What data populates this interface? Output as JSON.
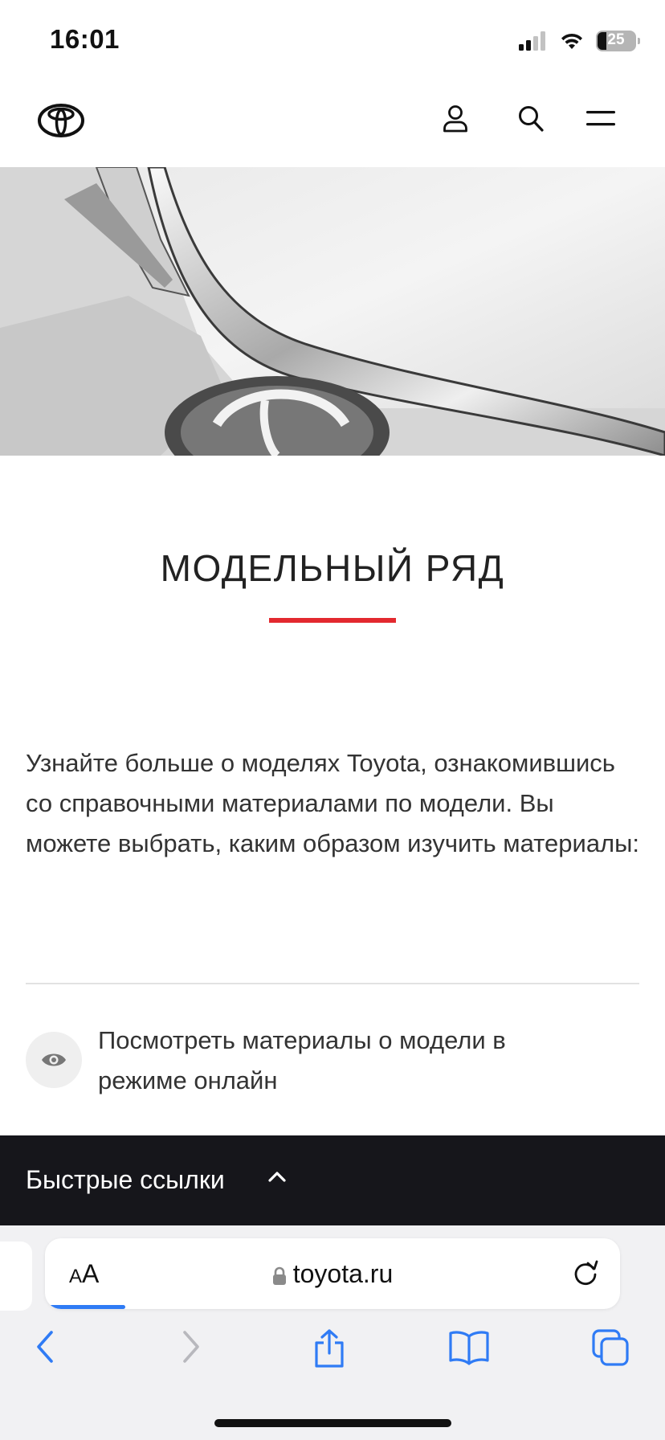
{
  "status_bar": {
    "time": "16:01",
    "battery_percent": "25"
  },
  "header": {
    "brand": "Toyota"
  },
  "main": {
    "title": "МОДЕЛЬНЫЙ РЯД",
    "intro": "Узнайте больше о моделях Toyota, ознакомившись со справочными материалами по модели. Вы можете выбрать, каким образом изучить материалы:",
    "options": [
      {
        "icon": "eye-icon",
        "label": "Посмотреть материалы о модели в режиме онлайн"
      }
    ]
  },
  "quick_links": {
    "label": "Быстрые ссылки"
  },
  "browser": {
    "text_size_label": "AA",
    "url": "toyota.ru",
    "load_progress": 0.14
  },
  "colors": {
    "accent": "#e3292f",
    "dark_bar": "#16161b",
    "link_blue": "#2f7bf5"
  }
}
